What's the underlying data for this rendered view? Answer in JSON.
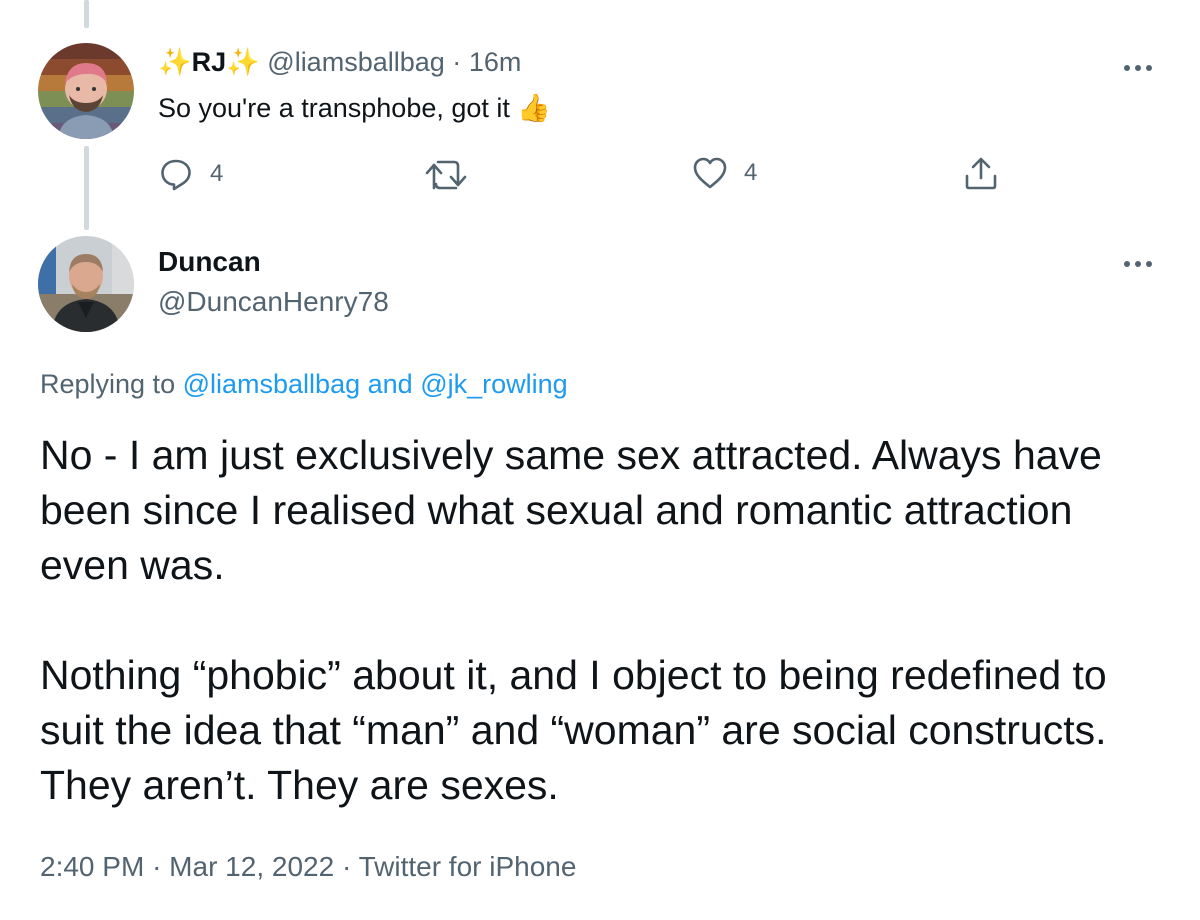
{
  "reply": {
    "display_name_prefix": "✨",
    "display_name": "RJ",
    "display_name_suffix": "✨",
    "handle": "@liamsballbag",
    "separator": "·",
    "time": "16m",
    "text": "So you're a transphobe, got it",
    "emoji": "👍",
    "reply_count": "4",
    "like_count": "4"
  },
  "main": {
    "display_name": "Duncan",
    "handle": "@DuncanHenry78",
    "replying_prefix": "Replying to",
    "replying_user1": "@liamsballbag",
    "replying_and": "and",
    "replying_user2": "@jk_rowling",
    "body_paragraph1": "No - I am just exclusively same sex attracted. Always have been since I realised what sexual and romantic attraction even was.",
    "body_paragraph2": "Nothing “phobic” about it, and I object to being redefined to suit the idea that “man” and “woman” are social constructs. They aren’t. They are sexes.",
    "time": "2:40 PM",
    "date": "Mar 12, 2022",
    "source": "Twitter for iPhone",
    "separator": "·"
  },
  "colors": {
    "text": "#0f1419",
    "muted": "#536471",
    "link": "#1d9bf0",
    "thread_line": "#cfd9de"
  },
  "icons": {
    "reply": "reply-icon",
    "retweet": "retweet-icon",
    "like": "heart-icon",
    "share": "share-icon",
    "more": "more-icon"
  }
}
